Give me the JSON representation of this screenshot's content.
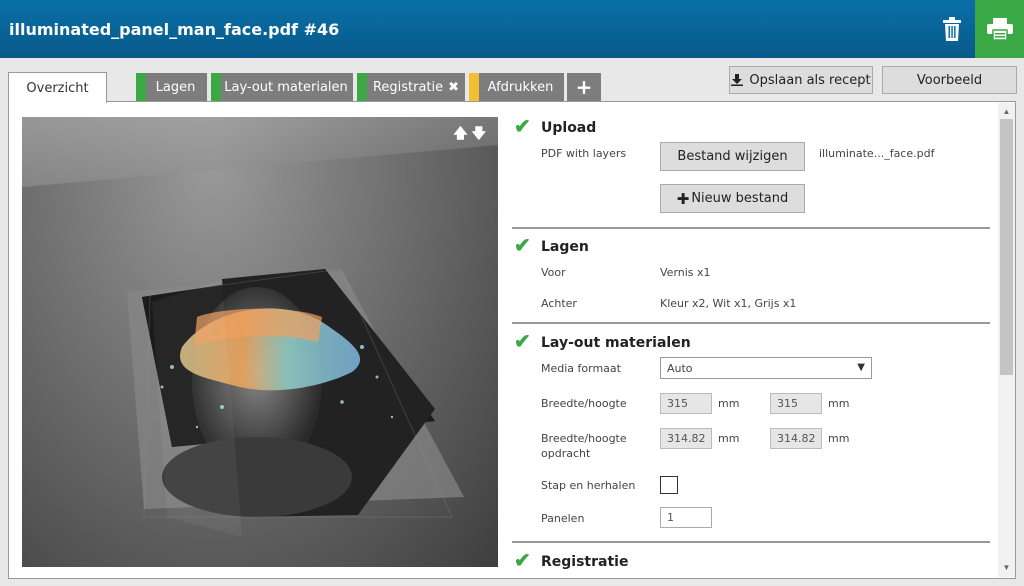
{
  "header": {
    "title": "illuminated_panel_man_face.pdf #46"
  },
  "icons": {
    "trash": "trash-icon",
    "print": "printer-icon"
  },
  "tabs": [
    {
      "label": "Overzicht",
      "active": true
    },
    {
      "label": "Lagen",
      "stripe": "#3aa845"
    },
    {
      "label": "Lay-out materialen",
      "stripe": "#3aa845"
    },
    {
      "label": "Registratie",
      "stripe": "#3aa845",
      "close": "✖"
    },
    {
      "label": "Afdrukken",
      "stripe": "#f0c030"
    },
    {
      "label": "+"
    }
  ],
  "toolbar": {
    "save_recipe": "Opslaan als recept",
    "preview": "Voorbeeld"
  },
  "colors": {
    "accent": "#3aa845",
    "header": "#0a6fa8",
    "warning": "#f0c030"
  },
  "upload": {
    "title": "Upload",
    "label": "PDF with layers",
    "change_button": "Bestand wijzigen",
    "filename": "illuminate..._face.pdf",
    "new_button": "Nieuw bestand"
  },
  "lagen": {
    "title": "Lagen",
    "front_label": "Voor",
    "front_value": "Vernis x1",
    "back_label": "Achter",
    "back_value": "Kleur x2, Wit x1, Grijs x1"
  },
  "layout": {
    "title": "Lay-out materialen",
    "media_label": "Media formaat",
    "media_value": "Auto",
    "wh_label": "Breedte/hoogte",
    "width": "315",
    "height": "315",
    "unit": "mm",
    "wh_order_label_1": "Breedte/hoogte",
    "wh_order_label_2": "opdracht",
    "order_width": "314.82",
    "order_height": "314.82",
    "step_repeat_label": "Stap en herhalen",
    "panels_label": "Panelen",
    "panels_value": "1"
  },
  "registratie": {
    "title": "Registratie"
  }
}
